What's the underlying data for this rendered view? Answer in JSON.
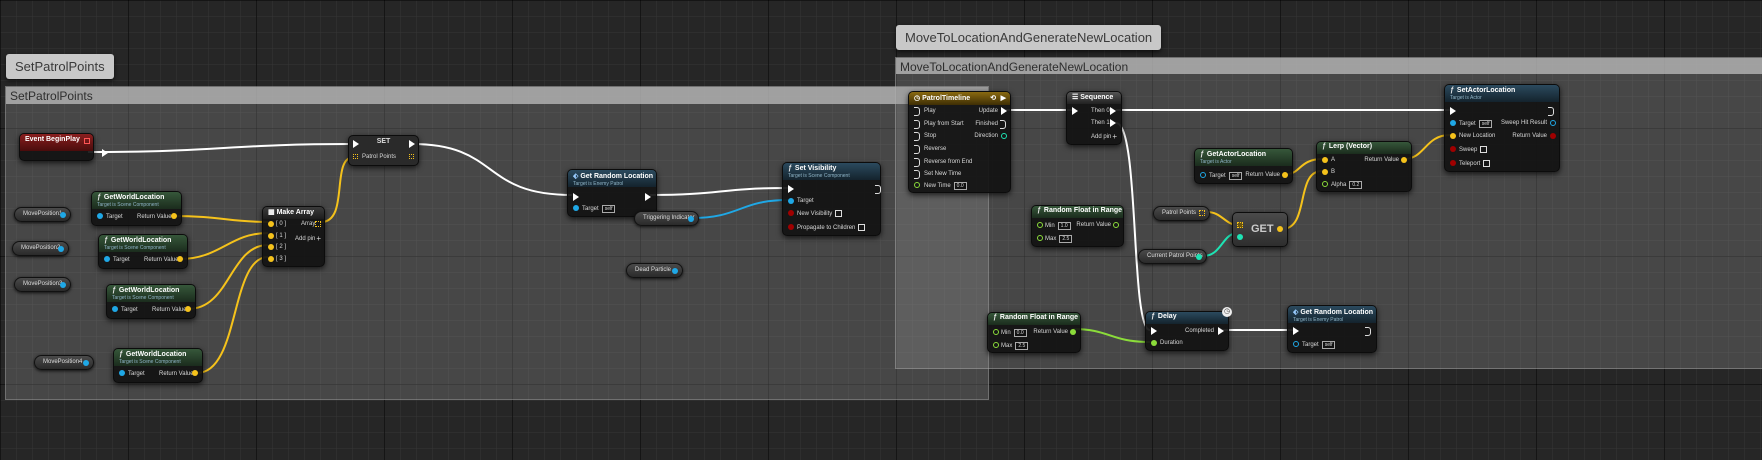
{
  "comments": {
    "patrol": {
      "tag": "SetPatrolPoints",
      "header": "SetPatrolPoints"
    },
    "move": {
      "tag": "MoveToLocationAndGenerateNewLocation",
      "header": "MoveToLocationAndGenerateNewLocation"
    }
  },
  "colors": {
    "exec": "#ffffff",
    "object": "#1fa8e6",
    "vector": "#f5c21b",
    "float": "#8bdc3a",
    "bool": "#a00000",
    "int": "#1ee3b4"
  },
  "nodes": {
    "begin_play": {
      "title": "Event BeginPlay"
    },
    "gwl1": {
      "title": "GetWorldLocation",
      "sub": "Target is Scene Component",
      "target": "Target",
      "ret": "Return Value"
    },
    "gwl2": {
      "title": "GetWorldLocation",
      "sub": "Target is Scene Component",
      "target": "Target",
      "ret": "Return Value"
    },
    "gwl3": {
      "title": "GetWorldLocation",
      "sub": "Target is Scene Component",
      "target": "Target",
      "ret": "Return Value"
    },
    "gwl4": {
      "title": "GetWorldLocation",
      "sub": "Target is Scene Component",
      "target": "Target",
      "ret": "Return Value"
    },
    "make_array": {
      "title": "Make Array",
      "in0": "[ 0 ]",
      "in1": "[ 1 ]",
      "in2": "[ 2 ]",
      "in3": "[ 3 ]",
      "array": "Array",
      "add": "Add pin"
    },
    "set_node": {
      "title": "SET",
      "pin": "Patrol Points"
    },
    "get_random_loc1": {
      "title": "Get Random Location",
      "sub": "Target is Enemy Patrol",
      "target": "Target",
      "self": "self"
    },
    "set_visibility": {
      "title": "Set Visibility",
      "sub": "Target is Scene Component",
      "target": "Target",
      "new_vis": "New Visibility",
      "propagate": "Propagate to Children"
    },
    "patrol_timeline": {
      "title": "PatrolTimeline",
      "play": "Play",
      "play_start": "Play from Start",
      "stop": "Stop",
      "reverse": "Reverse",
      "reverse_end": "Reverse from End",
      "set_time": "Set New Time",
      "new_time": "New Time",
      "new_time_val": "0.0",
      "update": "Update",
      "finished": "Finished",
      "direction": "Direction"
    },
    "sequence": {
      "title": "Sequence",
      "then0": "Then 0",
      "then1": "Then 1",
      "add": "Add pin"
    },
    "set_actor_loc": {
      "title": "SetActorLocation",
      "sub": "Target is Actor",
      "target": "Target",
      "self": "self",
      "new_loc": "New Location",
      "sweep": "Sweep",
      "teleport": "Teleport",
      "sweep_hit": "Sweep Hit Result",
      "ret": "Return Value"
    },
    "get_actor_loc": {
      "title": "GetActorLocation",
      "sub": "Target is Actor",
      "target": "Target",
      "self": "self",
      "ret": "Return Value"
    },
    "lerp": {
      "title": "Lerp (Vector)",
      "a": "A",
      "b": "B",
      "alpha": "Alpha",
      "alpha_val": "0.2",
      "ret": "Return Value"
    },
    "rand_float1": {
      "title": "Random Float in Range",
      "min": "Min",
      "min_val": "1.0",
      "max": "Max",
      "max_val": "2.5",
      "ret": "Return Value"
    },
    "get_node": {
      "title": "GET"
    },
    "rand_float2": {
      "title": "Random Float in Range",
      "min": "Min",
      "min_val": "0.0",
      "max": "Max",
      "max_val": "2.5",
      "ret": "Return Value"
    },
    "delay": {
      "title": "Delay",
      "duration": "Duration",
      "completed": "Completed"
    },
    "get_random_loc2": {
      "title": "Get Random Location",
      "sub": "Target is Enemy Patrol",
      "target": "Target",
      "self": "self"
    }
  },
  "variables": {
    "mp1": "MovePosition1",
    "mp2": "MovePosition2",
    "mp3": "MovePosition3",
    "mp4": "MovePosition4",
    "trig": "Triggering Indicator",
    "dead": "Dead Particle",
    "patrol_points": "Patrol Points",
    "current_points": "Current Patrol Points"
  }
}
